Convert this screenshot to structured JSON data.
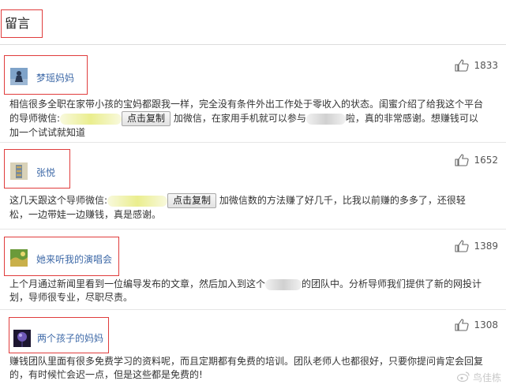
{
  "header": {
    "title": "留言"
  },
  "comments": [
    {
      "author": "梦瑶妈妈",
      "likes": "1833",
      "line1": "相信很多全职在家带小孩的宝妈都跟我一样，完全没有条件外出工作处于零收入的状态。闺蜜介绍了给我这个平台",
      "line2_a": "的导师微信:",
      "copy_label": "点击复制",
      "line2_b": "加微信，在家用手机就可以参与",
      "line2_c": "啦，真的非常感谢。想赚钱可以",
      "line3": "加一个试试就知道"
    },
    {
      "author": "张悦",
      "likes": "1652",
      "line1_a": "这几天跟这个导师微信:",
      "copy_label": "点击复制",
      "line1_b": "加微信数的方法赚了好几千，比我以前赚的多多了，还很轻",
      "line2": "松，一边带娃一边赚钱，真是感谢。"
    },
    {
      "author": "她来听我的演唱会",
      "likes": "1389",
      "line1_a": "上个月通过新闻里看到一位编导发布的文章，然后加入到这个",
      "line1_b": "的团队中。分析导师我们提供了新的网投计",
      "line2": "划，导师很专业，尽职尽责。"
    },
    {
      "author": "两个孩子的妈妈",
      "likes": "1308",
      "line1": "赚钱团队里面有很多免费学习的资料呢，而且定期都有免费的培训。团队老师人也都很好，只要你提问肯定会回复",
      "line2": "的，有时候忙会迟一点，但是这些都是免费的!"
    }
  ],
  "watermark": "鸟佳栋",
  "colors": {
    "accent_border": "#e03c3c",
    "author": "#3f6aa8"
  }
}
